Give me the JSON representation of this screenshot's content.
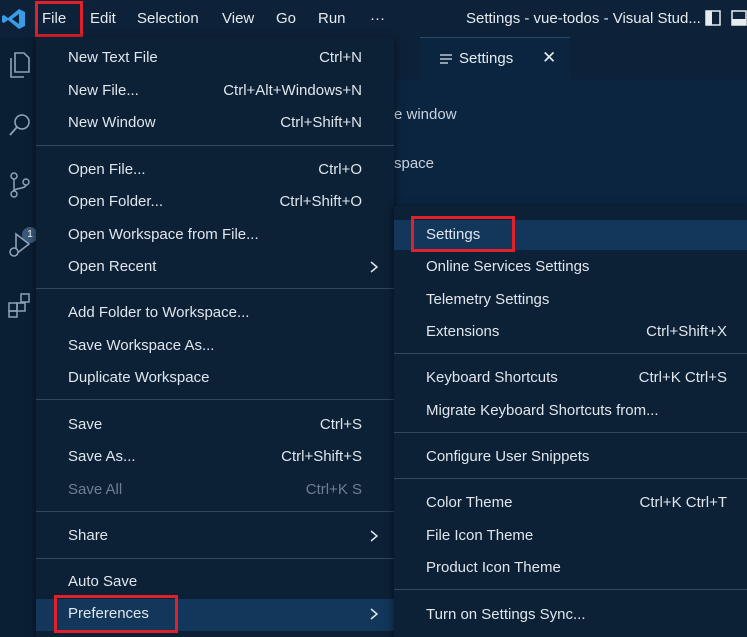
{
  "menubar": {
    "items": [
      "File",
      "Edit",
      "Selection",
      "View",
      "Go",
      "Run",
      "···"
    ],
    "title": "Settings - vue-todos - Visual Stud..."
  },
  "activity_badge": "1",
  "tab": {
    "label": "Settings",
    "close": "✕"
  },
  "background_text": {
    "line1": "e window",
    "line2": "space"
  },
  "file_menu": {
    "items": [
      {
        "label": "New Text File",
        "shortcut": "Ctrl+N"
      },
      {
        "label": "New File...",
        "shortcut": "Ctrl+Alt+Windows+N"
      },
      {
        "label": "New Window",
        "shortcut": "Ctrl+Shift+N"
      },
      {
        "label": "Open File...",
        "shortcut": "Ctrl+O"
      },
      {
        "label": "Open Folder...",
        "shortcut": "Ctrl+Shift+O"
      },
      {
        "label": "Open Workspace from File...",
        "shortcut": ""
      },
      {
        "label": "Open Recent",
        "shortcut": ""
      },
      {
        "label": "Add Folder to Workspace...",
        "shortcut": ""
      },
      {
        "label": "Save Workspace As...",
        "shortcut": ""
      },
      {
        "label": "Duplicate Workspace",
        "shortcut": ""
      },
      {
        "label": "Save",
        "shortcut": "Ctrl+S"
      },
      {
        "label": "Save As...",
        "shortcut": "Ctrl+Shift+S"
      },
      {
        "label": "Save All",
        "shortcut": "Ctrl+K S"
      },
      {
        "label": "Share",
        "shortcut": ""
      },
      {
        "label": "Auto Save",
        "shortcut": ""
      },
      {
        "label": "Preferences",
        "shortcut": ""
      }
    ]
  },
  "preferences_menu": {
    "items": [
      {
        "label": "Settings",
        "shortcut": ""
      },
      {
        "label": "Online Services Settings",
        "shortcut": ""
      },
      {
        "label": "Telemetry Settings",
        "shortcut": ""
      },
      {
        "label": "Extensions",
        "shortcut": "Ctrl+Shift+X"
      },
      {
        "label": "Keyboard Shortcuts",
        "shortcut": "Ctrl+K Ctrl+S"
      },
      {
        "label": "Migrate Keyboard Shortcuts from...",
        "shortcut": ""
      },
      {
        "label": "Configure User Snippets",
        "shortcut": ""
      },
      {
        "label": "Color Theme",
        "shortcut": "Ctrl+K Ctrl+T"
      },
      {
        "label": "File Icon Theme",
        "shortcut": ""
      },
      {
        "label": "Product Icon Theme",
        "shortcut": ""
      },
      {
        "label": "Turn on Settings Sync...",
        "shortcut": ""
      }
    ]
  },
  "colors": {
    "highlight_box": "#e0202b",
    "menu_bg": "#0c2036",
    "active_item_bg": "#12375a",
    "accent_logo": "#3a9be6"
  }
}
